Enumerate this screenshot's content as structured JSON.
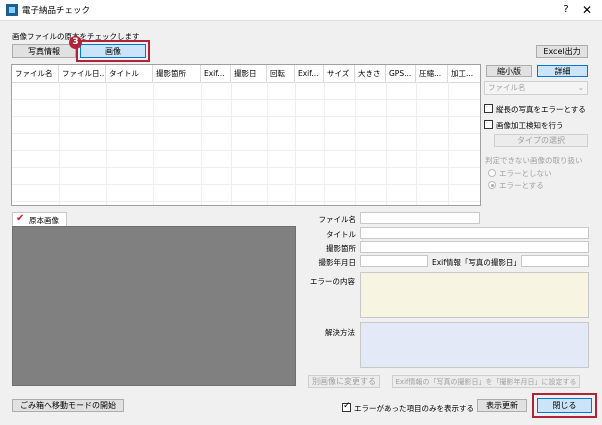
{
  "window": {
    "title": "電子納品チェック",
    "help": "?",
    "close": "✕"
  },
  "instruction": "画像ファイルの原本をチェックします",
  "callout": {
    "badge": "3"
  },
  "tabs": {
    "photo_info": "写真情報",
    "image": "画像"
  },
  "excel_button": "Excel出力",
  "view": {
    "thumbnail": "縮小版",
    "detail": "詳細"
  },
  "sort_select": {
    "value": "ファイル名"
  },
  "options": {
    "portrait_error": "縦長の写真をエラーとする",
    "detect_processing": "画像加工検知を行う",
    "type_select_button": "タイプの選択",
    "undetermined_heading": "判定できない画像の取り扱い",
    "radio_no_error": "エラーとしない",
    "radio_error": "エラーとする"
  },
  "table": {
    "columns": [
      "ファイル名",
      "ファイル日...",
      "タイトル",
      "撮影箇所",
      "Exif...",
      "撮影日",
      "回転",
      "Exif...",
      "サイズ",
      "大きさ",
      "GPS...",
      "圧縮...",
      "加工..."
    ]
  },
  "preview": {
    "tab_label": "原本画像"
  },
  "fields": {
    "file_name": "ファイル名",
    "title": "タイトル",
    "location": "撮影箇所",
    "shoot_date": "撮影年月日",
    "exif_date": "Exif情報「写真の撮影日」",
    "error_content": "エラーの内容",
    "solution": "解決方法"
  },
  "actions": {
    "change_image": "別画像に変更する",
    "set_exif_date": "Exif情報の「写真の撮影日」を「撮影年月日」に設定する",
    "trash_mode": "ごみ箱へ移動モードの開始",
    "show_errors_only": "エラーがあった項目のみを表示する",
    "refresh": "表示更新",
    "close": "閉じる"
  },
  "colors": {
    "callout": "#b0243a",
    "error_box": "#f7f5e2",
    "solution_box": "#e3e9f7",
    "selected": "#cce4f7"
  }
}
